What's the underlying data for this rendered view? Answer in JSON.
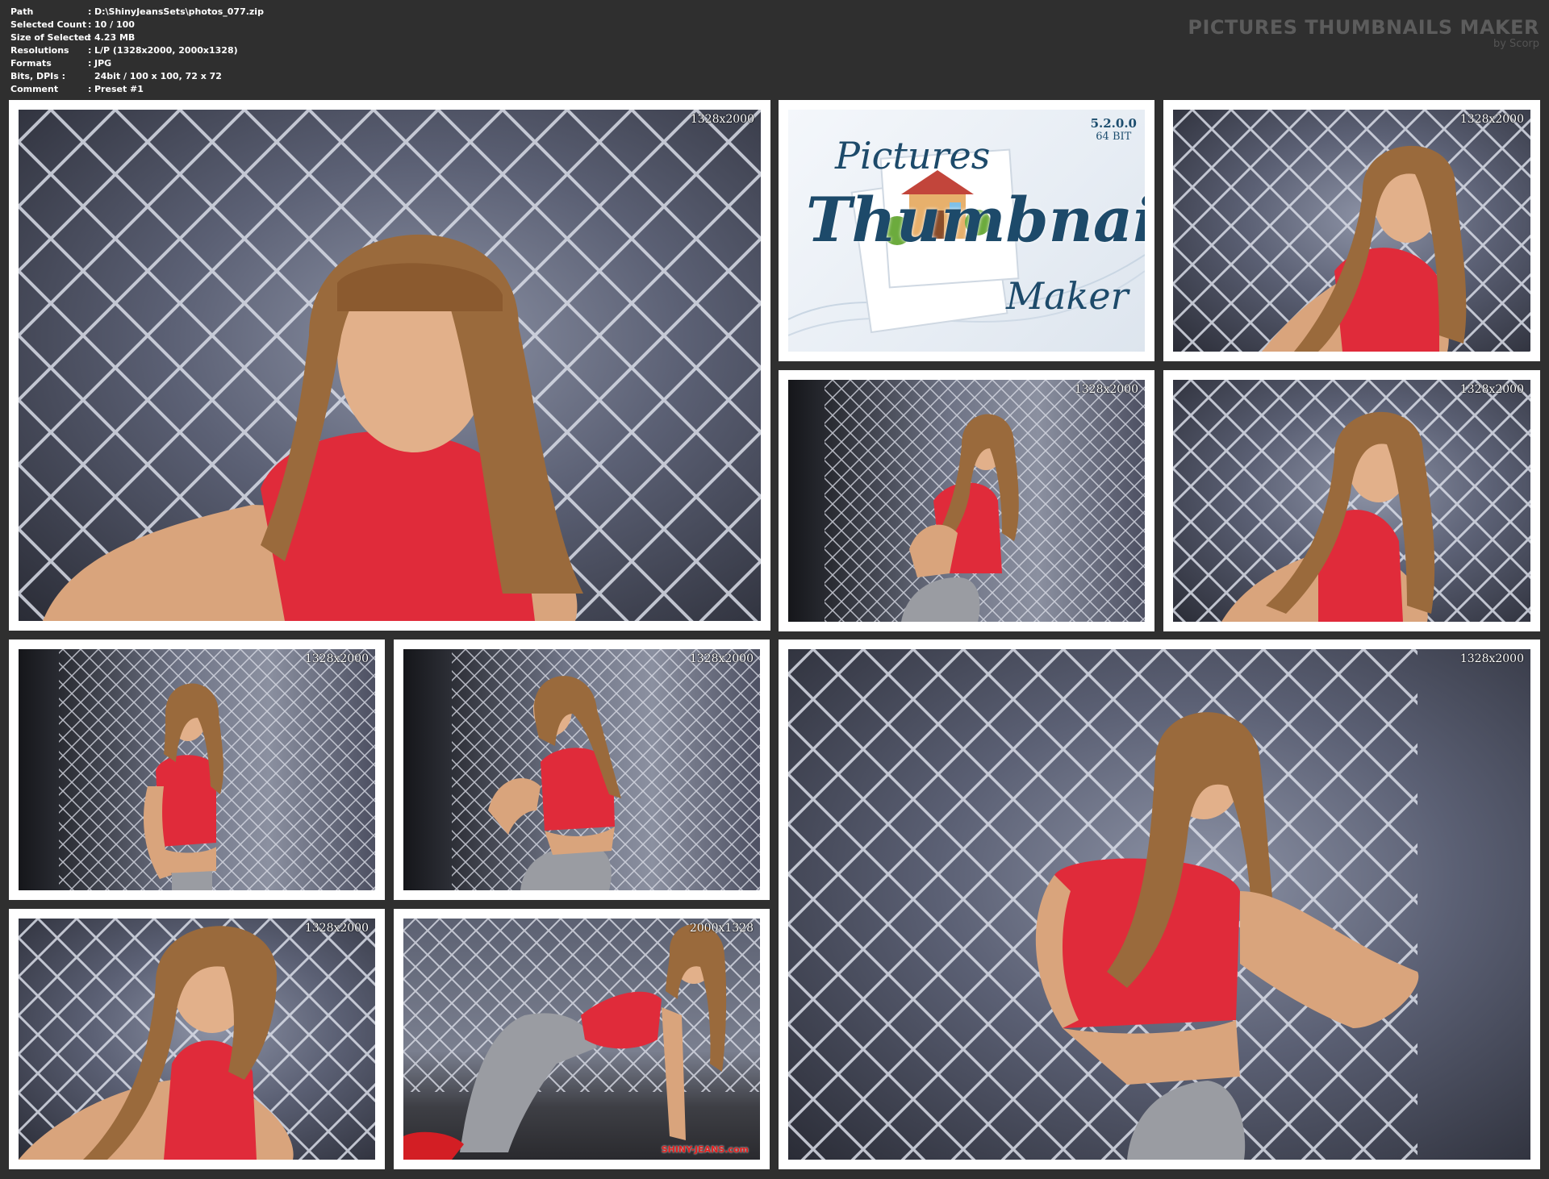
{
  "info": [
    {
      "key": "Path",
      "value": "D:\\ShinyJeansSets\\photos_077.zip"
    },
    {
      "key": "Selected Count",
      "value": "10 / 100"
    },
    {
      "key": "Size of Selected",
      "value": "4.23 MB"
    },
    {
      "key": "Resolutions",
      "value": "L/P (1328x2000, 2000x1328)"
    },
    {
      "key": "Formats",
      "value": "JPG"
    },
    {
      "key": "Bits, DPIs :",
      "value": "24bit / 100 x 100, 72 x 72"
    },
    {
      "key": "Comment",
      "value": "Preset #1"
    }
  ],
  "brand": {
    "title": "PICTURES THUMBNAILS MAKER",
    "subtitle": "by Scorp"
  },
  "logo": {
    "version": "5.2.0.0",
    "bits": "64 BIT",
    "word1": "Pictures",
    "word2": "Thumbnails",
    "word3": "Maker"
  },
  "thumbs": [
    {
      "res": "1328x2000"
    },
    {
      "res": "1328x2000"
    },
    {
      "res": "1328x2000"
    },
    {
      "res": "1328x2000"
    },
    {
      "res": "1328x2000"
    },
    {
      "res": "1328x2000"
    },
    {
      "res": "1328x2000"
    },
    {
      "res": "2000x1328",
      "watermark": "SHINY-JEANS.com"
    },
    {
      "res": "1328x2000"
    }
  ],
  "colors": {
    "background": "#2f2f2f",
    "frame": "#ffffff",
    "top_red": "#e4283a",
    "pants": "#9a9ca2",
    "hair": "#9a6a3c"
  }
}
